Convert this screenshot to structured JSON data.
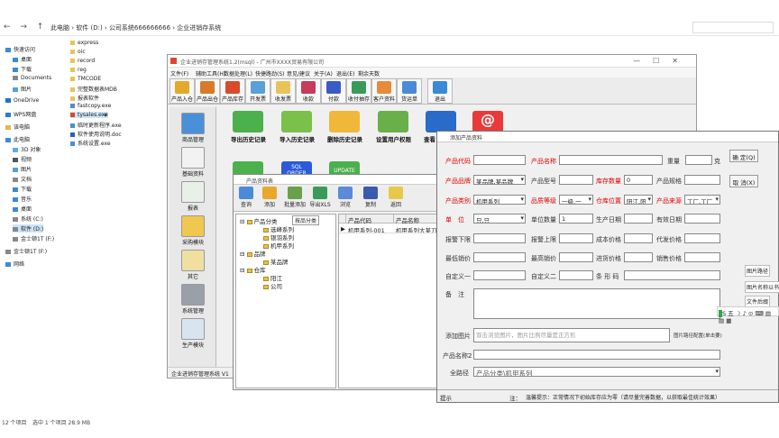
{
  "explorer": {
    "breadcrumb": [
      "此电脑",
      "软件 (D:)",
      "公司系统666666666",
      "企业进销存系统"
    ],
    "sidebar": [
      "快速访问",
      "桌面",
      "下载",
      "Documents",
      "图片",
      "OneDrive",
      "WPS网盘",
      "该电脑",
      "此电脑",
      "3D 对象",
      "视频",
      "图片",
      "文档",
      "下载",
      "音乐",
      "桌面",
      "系统 (C:)",
      "软件 (D:)",
      "金士顿1T (F:)",
      "金士顿1T (F:)",
      "网络"
    ],
    "files": [
      "express",
      "oic",
      "record",
      "reg",
      "TMCODE",
      "完整数据表MDB",
      "报表软件",
      "fastcopy.exe",
      "tysales.exe",
      "临时更新程序.exe",
      "软件使用说明.doc",
      "系统设置.exe"
    ],
    "selected_file": "tysales.exe",
    "status": [
      "12 个项目",
      "选中 1 个项目 28.9 MB"
    ]
  },
  "main_window": {
    "title": "企业进销存管理系统1.2(msql) - 广州市XXXX贸易有限公司",
    "menu": [
      "文件(F)",
      "辅助工具(H)",
      "数据处理(L)",
      "快捷路劲(S)",
      "意见/建议",
      "关于(A)",
      "退出(E)",
      "剩余天数"
    ],
    "toolbar": [
      "产品入仓",
      "产品出仓",
      "产品库存",
      "开发票",
      "收发票",
      "收款",
      "付款",
      "收付抽存",
      "客户资料",
      "货运单",
      "退出"
    ],
    "left_nav": [
      "商品管理",
      "基础资料",
      "报表",
      "采购模块",
      "其它",
      "系统管理",
      "生产模块"
    ],
    "big_buttons": [
      "导出历史记录",
      "导入历史记录",
      "删除历史记录",
      "设置用户权限",
      "查看"
    ],
    "row2_icons": [
      "SQL ORDER",
      "UPDATE"
    ],
    "status": "企业进销存管理系统 V1"
  },
  "product_window": {
    "title": "产品资料表",
    "toolbar": [
      "查询",
      "添加",
      "批量添加",
      "导出XLS",
      "浏览",
      "复制",
      "返回"
    ],
    "search_label": "按品分类",
    "tree": [
      "产品分类",
      "选峰系列",
      "银羽系列",
      "机甲系列",
      "品牌",
      "某品牌",
      "仓库",
      "阳江",
      "公司"
    ],
    "grid_headers": [
      "产品代码",
      "产品名称"
    ],
    "grid_row": [
      "机甲系列-001",
      "机甲系列大某刀"
    ]
  },
  "add_dialog": {
    "title": "添加产品资料",
    "labels": {
      "code": "产品代码",
      "name": "产品名称",
      "weight": "重量",
      "weight_unit": "克",
      "brand": "产品品牌",
      "model": "产品型号",
      "stock_qty": "库存数量",
      "spec": "产品规格",
      "category": "产品类别",
      "grade": "品质等级",
      "warehouse": "仓库位置",
      "source": "产品来源",
      "unit": "单　位",
      "unit_qty": "单位数量",
      "prod_date": "生产日期",
      "valid_date": "有效日期",
      "alarm_low": "报警下限",
      "alarm_high": "报警上限",
      "cost": "成本价格",
      "agent_price": "代发价格",
      "min_price": "最低销价",
      "max_price": "最高销价",
      "purchase_price": "进货价格",
      "sale_price": "销售价格",
      "custom1": "自定义一",
      "custom2": "自定义二",
      "barcode": "条 形 码",
      "remark": "备　注",
      "add_image": "添加图片",
      "name2": "产品名称2",
      "full_path": "全路径"
    },
    "values": {
      "brand": "某品牌,某品牌",
      "stock_qty": "0",
      "category": "机甲系列",
      "grade": "一级,一",
      "warehouse": "阳江,阳",
      "source": "工厂,工厂",
      "unit": "只,只",
      "unit_qty": "1",
      "full_path": "产品分类\\机甲系列"
    },
    "image_hint": "双击浏览图片，图片比例尽量是正方形",
    "image_path_label": "图片路径配置(单击要)",
    "buttons": [
      "确 定(Q)",
      "取 消(X)"
    ],
    "footer": [
      "提示",
      "注：",
      "温馨提示：正常情况下初始库存应为零（请尽量完善数据，以获取最佳统计效果）"
    ]
  },
  "right_strip": [
    "图片路径",
    "图片名称以书分",
    "文件后缀"
  ],
  "ime_bar": "S 五 ☽ ♪ ⊙ ⌨ ▤ ▤ ▦"
}
